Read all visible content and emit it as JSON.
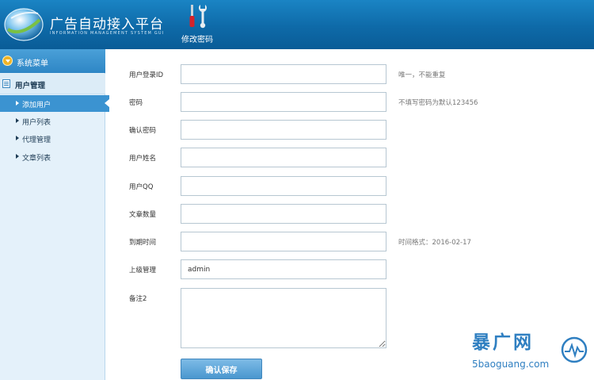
{
  "header": {
    "title": "广告自动接入平台",
    "subtitle": "INFORMATION MANAGEMENT SYSTEM GUI",
    "tools": [
      {
        "label": "修改密码",
        "icon": "wrench-screwdriver-icon"
      }
    ]
  },
  "sidebar": {
    "menu_title": "系统菜单",
    "group_title": "用户管理",
    "items": [
      {
        "label": "添加用户",
        "active": true
      },
      {
        "label": "用户列表",
        "active": false
      },
      {
        "label": "代理管理",
        "active": false
      },
      {
        "label": "文章列表",
        "active": false
      }
    ]
  },
  "form": {
    "fields": [
      {
        "label": "用户登录ID",
        "value": "",
        "hint": "唯一，不能重复"
      },
      {
        "label": "密码",
        "value": "",
        "hint": "不填写密码为默认123456"
      },
      {
        "label": "确认密码",
        "value": "",
        "hint": ""
      },
      {
        "label": "用户姓名",
        "value": "",
        "hint": ""
      },
      {
        "label": "用户QQ",
        "value": "",
        "hint": ""
      },
      {
        "label": "文章数量",
        "value": "",
        "hint": ""
      },
      {
        "label": "到期时间",
        "value": "",
        "hint": "时间格式：2016-02-17"
      },
      {
        "label": "上级管理",
        "value": "admin",
        "hint": ""
      }
    ],
    "note_label": "备注2",
    "note_value": "",
    "submit_label": "确认保存"
  },
  "watermark": {
    "main": "暴广网",
    "sub": "5baoguang.com"
  },
  "colors": {
    "header_blue": "#0e6aa8",
    "menu_blue": "#2e86c5",
    "active_item": "#3b93d1",
    "sidebar_bg": "#e4f1fa",
    "watermark_blue": "#2f7fc1"
  }
}
